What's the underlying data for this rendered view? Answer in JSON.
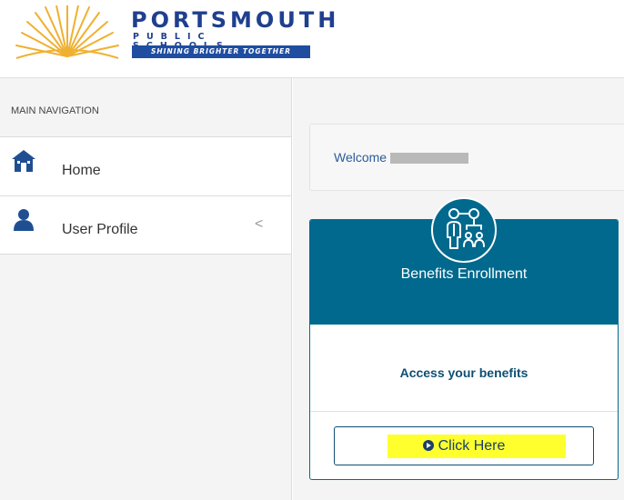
{
  "header": {
    "logo": {
      "title": "PORTSMOUTH",
      "subtitle": "PUBLIC SCHOOLS",
      "tagline": "SHINING BRIGHTER TOGETHER"
    }
  },
  "sidebar": {
    "heading": "MAIN NAVIGATION",
    "items": [
      {
        "label": "Home",
        "icon": "home-icon"
      },
      {
        "label": "User Profile",
        "icon": "user-icon",
        "chevron": "<"
      }
    ]
  },
  "main": {
    "welcome_label": "Welcome",
    "card": {
      "icon": "org-chart-icon",
      "title": "Benefits Enrollment",
      "subtitle": "Access your benefits",
      "button_label": "Click Here"
    }
  },
  "colors": {
    "brand_blue": "#1f3f8f",
    "card_teal": "#00698d",
    "highlight": "#ffff2e"
  }
}
